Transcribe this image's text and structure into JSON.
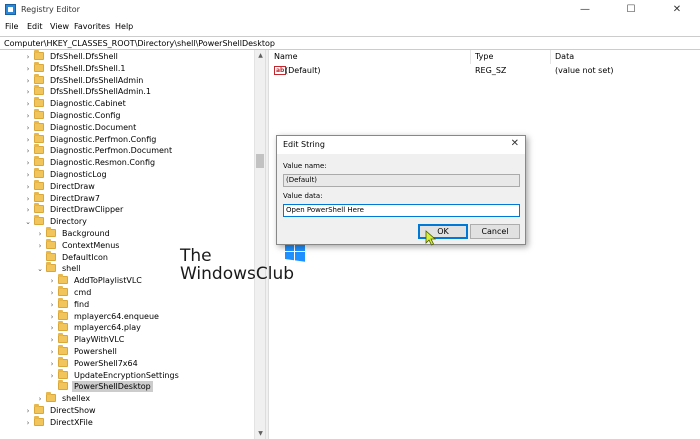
{
  "window": {
    "title": "Registry Editor",
    "minimize": "—",
    "maximize": "☐",
    "close": "✕"
  },
  "menu": [
    "File",
    "Edit",
    "View",
    "Favorites",
    "Help"
  ],
  "address": "Computer\\HKEY_CLASSES_ROOT\\Directory\\shell\\PowerShellDesktop",
  "tree": [
    {
      "label": "DfsShell.DfsShell",
      "expander": "›"
    },
    {
      "label": "DfsShell.DfsShell.1",
      "expander": "›"
    },
    {
      "label": "DfsShell.DfsShellAdmin",
      "expander": "›"
    },
    {
      "label": "DfsShell.DfsShellAdmin.1",
      "expander": "›"
    },
    {
      "label": "Diagnostic.Cabinet",
      "expander": "›"
    },
    {
      "label": "Diagnostic.Config",
      "expander": "›"
    },
    {
      "label": "Diagnostic.Document",
      "expander": "›"
    },
    {
      "label": "Diagnostic.Perfmon.Config",
      "expander": "›"
    },
    {
      "label": "Diagnostic.Perfmon.Document",
      "expander": "›"
    },
    {
      "label": "Diagnostic.Resmon.Config",
      "expander": "›"
    },
    {
      "label": "DiagnosticLog",
      "expander": "›"
    },
    {
      "label": "DirectDraw",
      "expander": "›"
    },
    {
      "label": "DirectDraw7",
      "expander": "›"
    },
    {
      "label": "DirectDrawClipper",
      "expander": "›"
    },
    {
      "label": "Directory",
      "expander": "⌄"
    },
    {
      "label": "Background",
      "expander": "›"
    },
    {
      "label": "ContextMenus",
      "expander": "›"
    },
    {
      "label": "DefaultIcon",
      "expander": ""
    },
    {
      "label": "shell",
      "expander": "⌄"
    },
    {
      "label": "AddToPlaylistVLC",
      "expander": "›"
    },
    {
      "label": "cmd",
      "expander": "›"
    },
    {
      "label": "find",
      "expander": "›"
    },
    {
      "label": "mplayerc64.enqueue",
      "expander": "›"
    },
    {
      "label": "mplayerc64.play",
      "expander": "›"
    },
    {
      "label": "PlayWithVLC",
      "expander": "›"
    },
    {
      "label": "Powershell",
      "expander": "›"
    },
    {
      "label": "PowerShell7x64",
      "expander": "›"
    },
    {
      "label": "UpdateEncryptionSettings",
      "expander": "›"
    },
    {
      "label": "PowerShellDesktop",
      "expander": "",
      "selected": true
    },
    {
      "label": "shellex",
      "expander": "›"
    },
    {
      "label": "DirectShow",
      "expander": "›"
    },
    {
      "label": "DirectXFile",
      "expander": "›"
    }
  ],
  "list": {
    "columns": [
      "Name",
      "Type",
      "Data"
    ],
    "rows": [
      {
        "icon": "ab",
        "name": "(Default)",
        "type": "REG_SZ",
        "data": "(value not set)"
      }
    ]
  },
  "dialog": {
    "title": "Edit String",
    "close": "✕",
    "value_name_label": "Value name:",
    "value_name": "(Default)",
    "value_data_label": "Value data:",
    "value_data": "Open PowerShell Here",
    "ok_label": "OK",
    "cancel_label": "Cancel"
  },
  "watermark": {
    "line1": "The",
    "line2": "WindowsClub"
  },
  "colors": {
    "accent": "#0078d7",
    "folder": "#f2c55c",
    "selection": "#cccccc"
  }
}
